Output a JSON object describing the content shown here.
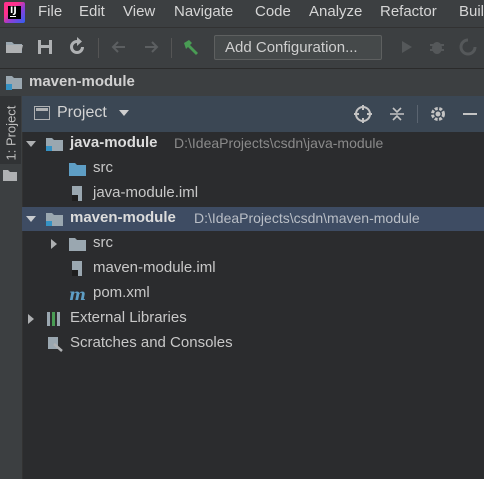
{
  "menubar": {
    "items": [
      "File",
      "Edit",
      "View",
      "Navigate",
      "Code",
      "Analyze",
      "Refactor",
      "Buil"
    ]
  },
  "toolbar": {
    "add_configuration": "Add Configuration..."
  },
  "navbar": {
    "project_name": "maven-module"
  },
  "sidebar": {
    "tab_label": "1: Project"
  },
  "panel": {
    "view_title": "Project"
  },
  "tree": {
    "rows": [
      {
        "label": "java-module",
        "path": "D:\\IdeaProjects\\csdn\\java-module"
      },
      {
        "label": "src"
      },
      {
        "label": "java-module.iml"
      },
      {
        "label": "maven-module",
        "path": "D:\\IdeaProjects\\csdn\\maven-module"
      },
      {
        "label": "src"
      },
      {
        "label": "maven-module.iml"
      },
      {
        "label": "pom.xml"
      },
      {
        "label": "External Libraries"
      },
      {
        "label": "Scratches and Consoles"
      }
    ]
  },
  "colors": {
    "background": "#2b2c2e",
    "chrome": "#3c3f41",
    "selection": "#3e4c63",
    "folder_blue": "#5e9ec5",
    "logo_pink": "#ff318c"
  }
}
